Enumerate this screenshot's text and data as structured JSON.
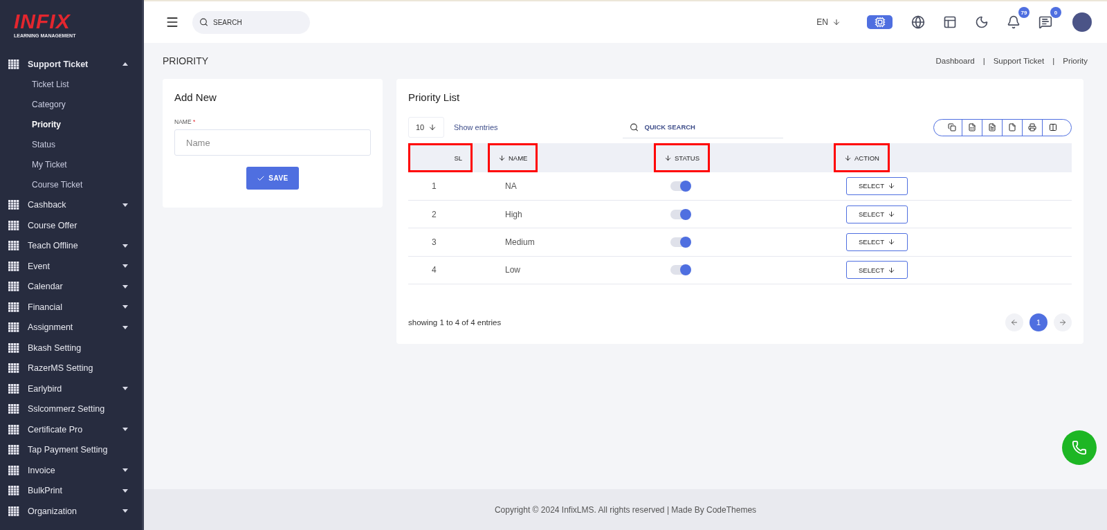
{
  "logo": {
    "brand": "INFIX",
    "tagline": "LEARNING MANAGEMENT"
  },
  "sidebar": {
    "items": [
      {
        "label": "Support Ticket",
        "expandable": true,
        "expanded": true,
        "children": [
          {
            "label": "Ticket List",
            "selected": false
          },
          {
            "label": "Category",
            "selected": false
          },
          {
            "label": "Priority",
            "selected": true
          },
          {
            "label": "Status",
            "selected": false
          },
          {
            "label": "My Ticket",
            "selected": false
          },
          {
            "label": "Course Ticket",
            "selected": false
          }
        ]
      },
      {
        "label": "Cashback",
        "expandable": true,
        "expanded": false
      },
      {
        "label": "Course Offer",
        "expandable": false,
        "expanded": false
      },
      {
        "label": "Teach Offline",
        "expandable": true,
        "expanded": false
      },
      {
        "label": "Event",
        "expandable": true,
        "expanded": false
      },
      {
        "label": "Calendar",
        "expandable": true,
        "expanded": false
      },
      {
        "label": "Financial",
        "expandable": true,
        "expanded": false
      },
      {
        "label": "Assignment",
        "expandable": true,
        "expanded": false
      },
      {
        "label": "Bkash Setting",
        "expandable": false,
        "expanded": false
      },
      {
        "label": "RazerMS Setting",
        "expandable": false,
        "expanded": false
      },
      {
        "label": "Earlybird",
        "expandable": true,
        "expanded": false
      },
      {
        "label": "Sslcommerz Setting",
        "expandable": false,
        "expanded": false
      },
      {
        "label": "Certificate Pro",
        "expandable": true,
        "expanded": false
      },
      {
        "label": "Tap Payment Setting",
        "expandable": false,
        "expanded": false
      },
      {
        "label": "Invoice",
        "expandable": true,
        "expanded": false
      },
      {
        "label": "BulkPrint",
        "expandable": true,
        "expanded": false
      },
      {
        "label": "Organization",
        "expandable": true,
        "expanded": false
      }
    ]
  },
  "header": {
    "search": {
      "placeholder": "SEARCH"
    },
    "language": "EN",
    "notifications": "79",
    "messages": "0"
  },
  "page_title": "PRIORITY",
  "breadcrumb": [
    {
      "label": "Dashboard"
    },
    {
      "separator": "|",
      "label": "Support Ticket"
    },
    {
      "separator": "|",
      "label": "Priority"
    }
  ],
  "add_new": {
    "title": "Add New",
    "field_label": "NAME",
    "required_mark": "*",
    "placeholder": "Name",
    "save_label": "SAVE"
  },
  "priority_list": {
    "title": "Priority List",
    "page_size": "10",
    "show_entries": "Show entries",
    "quick_search": {
      "placeholder": "QUICK SEARCH"
    },
    "columns": [
      {
        "label": "SL",
        "sortable": false,
        "highlighted": true
      },
      {
        "label": "NAME",
        "sortable": true,
        "highlighted": true
      },
      {
        "label": "STATUS",
        "sortable": true,
        "highlighted": true
      },
      {
        "label": "ACTION",
        "sortable": true,
        "highlighted": true
      }
    ],
    "rows": [
      {
        "sl": "1",
        "name": "NA",
        "on": true,
        "action": "SELECT"
      },
      {
        "sl": "2",
        "name": "High",
        "on": true,
        "action": "SELECT"
      },
      {
        "sl": "3",
        "name": "Medium",
        "on": true,
        "action": "SELECT"
      },
      {
        "sl": "4",
        "name": "Low",
        "on": true,
        "action": "SELECT"
      }
    ],
    "summary": "showing 1 to 4 of 4 entries",
    "pages": [
      {
        "label": "1",
        "selected": true
      }
    ]
  },
  "footer": "Copyright © 2024 InfixLMS. All rights reserved | Made By CodeThemes"
}
